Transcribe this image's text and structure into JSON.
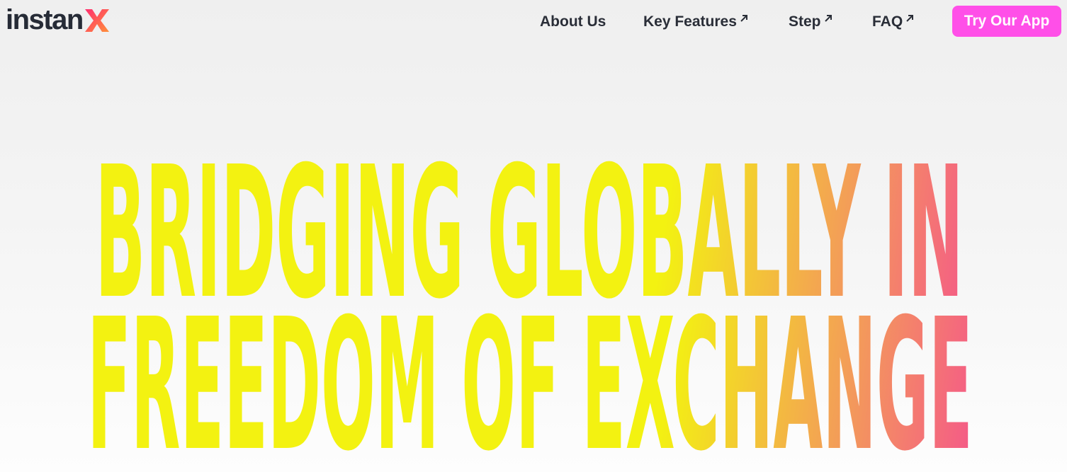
{
  "brand": {
    "logo_text": "instan",
    "logo_mark": "X",
    "logo_mark_colors": [
      "#ff3b6b",
      "#ff8a3d"
    ]
  },
  "nav": {
    "items": [
      {
        "label": "About Us",
        "external_arrow": false
      },
      {
        "label": "Key Features",
        "external_arrow": true
      },
      {
        "label": "Step",
        "external_arrow": true
      },
      {
        "label": "FAQ",
        "external_arrow": true
      }
    ],
    "arrow_icon": "arrow-up-right-icon",
    "cta_label": "Try Our App"
  },
  "hero": {
    "line1": "BRIDGING GLOBALLY IN",
    "line2": "FREEDOM OF EXCHANGE",
    "gradient_stops": [
      "#f3f211",
      "#f39b5a",
      "#f53f9a",
      "#8e4fd1",
      "#5650ee",
      "#5650ee"
    ]
  },
  "colors": {
    "cta_bg": "#ff4fe8",
    "nav_text": "#2a2e38",
    "background_top": "#efefef",
    "background_bottom": "#fdfdfd"
  }
}
